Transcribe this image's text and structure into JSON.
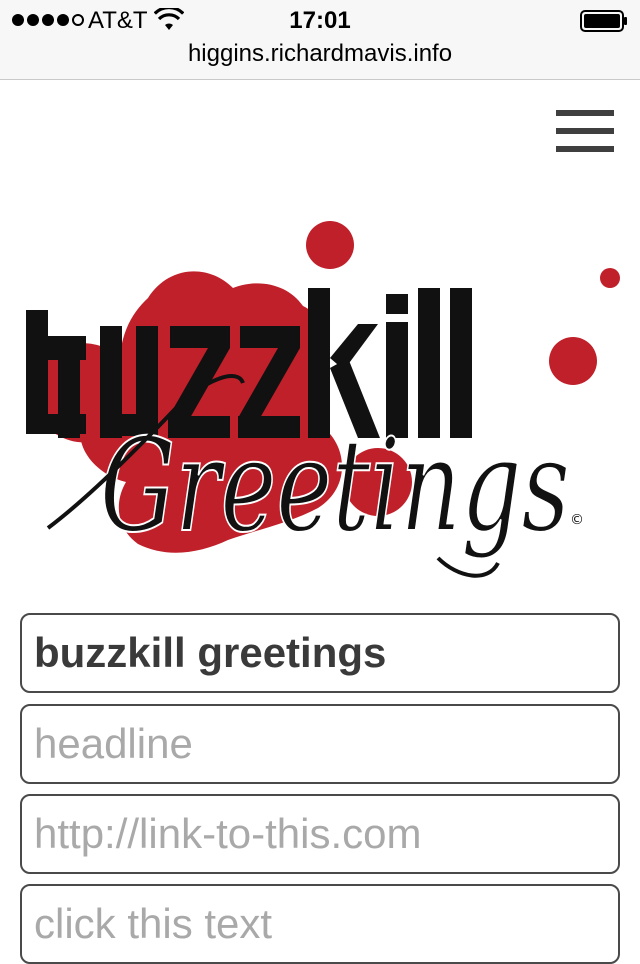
{
  "status_bar": {
    "carrier": "AT&T",
    "time": "17:01",
    "signal_bars_filled": 4,
    "signal_bars_total": 5,
    "battery_level": 1.0
  },
  "browser": {
    "url": "higgins.richardmavis.info"
  },
  "header": {
    "menu_icon": "hamburger-menu-icon"
  },
  "logo": {
    "text_top": "buzzkill",
    "text_bottom": "Greetings",
    "copyright": "©",
    "splatter_color": "#c0202a",
    "ink_color": "#111111"
  },
  "form": {
    "title_value": "buzzkill greetings",
    "title_placeholder": "",
    "headline_value": "",
    "headline_placeholder": "headline",
    "link_value": "",
    "link_placeholder": "http://link-to-this.com",
    "link_text_value": "",
    "link_text_placeholder": "click this text"
  }
}
